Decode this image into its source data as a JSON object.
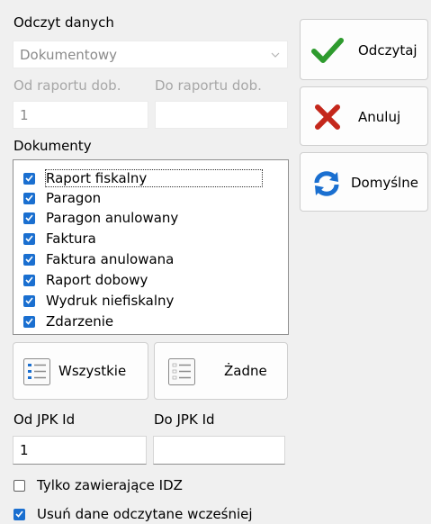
{
  "read_section": {
    "heading": "Odczyt danych",
    "mode_value": "Dokumentowy",
    "from_report_label": "Od raportu dob.",
    "to_report_label": "Do raportu dob.",
    "from_report_value": "1",
    "to_report_value": ""
  },
  "actions": {
    "read_label": "Odczytaj",
    "cancel_label": "Anuluj",
    "defaults_label": "Domyślne"
  },
  "documents": {
    "heading": "Dokumenty",
    "items": [
      {
        "label": "Raport fiskalny",
        "checked": true
      },
      {
        "label": "Paragon",
        "checked": true
      },
      {
        "label": "Paragon anulowany",
        "checked": true
      },
      {
        "label": "Faktura",
        "checked": true
      },
      {
        "label": "Faktura anulowana",
        "checked": true
      },
      {
        "label": "Raport dobowy",
        "checked": true
      },
      {
        "label": "Wydruk niefiskalny",
        "checked": true
      },
      {
        "label": "Zdarzenie",
        "checked": true
      }
    ],
    "select_all_label": "Wszystkie",
    "select_none_label": "Żadne"
  },
  "jpk": {
    "from_label": "Od JPK Id",
    "to_label": "Do JPK Id",
    "from_value": "1",
    "to_value": ""
  },
  "options": {
    "only_idz_label": "Tylko zawierające IDZ",
    "only_idz_checked": false,
    "delete_prev_label": "Usuń dane odczytane wcześniej",
    "delete_prev_checked": true
  },
  "colors": {
    "accent": "#1a6fd0",
    "check_green": "#2e9b2e",
    "cross_red": "#c4271b",
    "refresh_blue": "#1a6fd0"
  },
  "icons": [
    "chevron-down-icon",
    "checkmark-icon",
    "cross-icon",
    "refresh-icon",
    "list-all-icon",
    "list-none-icon"
  ]
}
